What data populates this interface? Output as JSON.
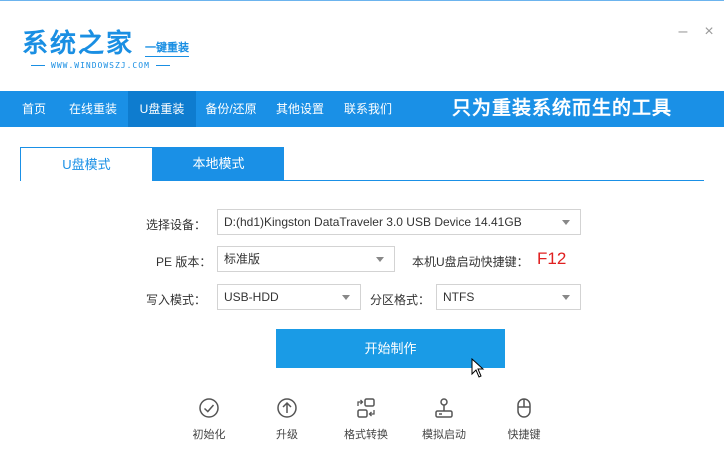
{
  "app": {
    "logo_main": "系统之家",
    "logo_tag": "一键重装",
    "logo_url": "WWW.WINDOWSZJ.COM",
    "minimize_label": "–",
    "close_label": "×"
  },
  "nav": {
    "items": [
      {
        "label": "首页"
      },
      {
        "label": "在线重装"
      },
      {
        "label": "U盘重装",
        "active": true
      },
      {
        "label": "备份/还原"
      },
      {
        "label": "其他设置"
      },
      {
        "label": "联系我们"
      }
    ],
    "slogan": "只为重装系统而生的工具"
  },
  "tabs": [
    {
      "label": "U盘模式",
      "active": true
    },
    {
      "label": "本地模式"
    }
  ],
  "form": {
    "device_label": "选择设备：",
    "device_value": "D:(hd1)Kingston DataTraveler 3.0 USB Device 14.41GB",
    "pe_label": "PE 版本：",
    "pe_value": "标准版",
    "hotkey_label": "本机U盘启动快捷键：",
    "hotkey_value": "F12",
    "write_label": "写入模式：",
    "write_value": "USB-HDD",
    "partition_label": "分区格式：",
    "partition_value": "NTFS"
  },
  "start_button": "开始制作",
  "tools": [
    {
      "label": "初始化",
      "icon": "check-circle-icon"
    },
    {
      "label": "升级",
      "icon": "upload-circle-icon"
    },
    {
      "label": "格式转换",
      "icon": "convert-icon"
    },
    {
      "label": "模拟启动",
      "icon": "joystick-icon"
    },
    {
      "label": "快捷键",
      "icon": "mouse-icon"
    }
  ],
  "colors": {
    "primary": "#1a90e6",
    "hotkey": "#e02020"
  }
}
